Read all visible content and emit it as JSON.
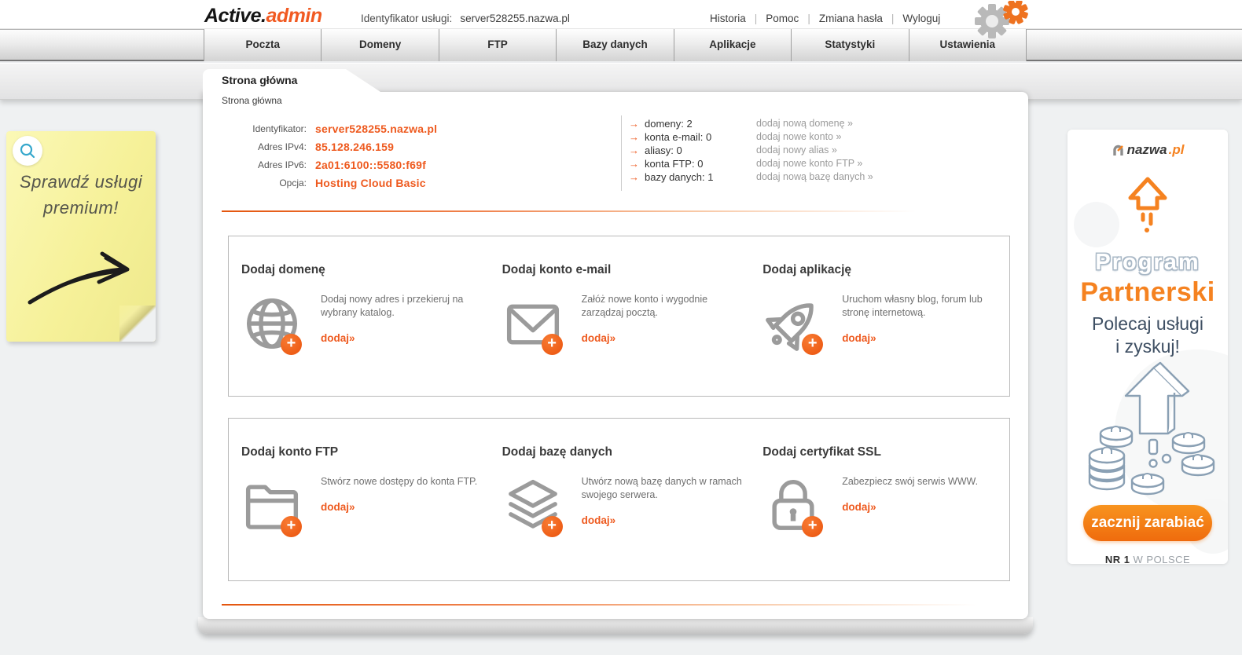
{
  "header": {
    "logo_part1": "Active.",
    "logo_part2": "admin",
    "service_label": "Identyfikator usługi:",
    "service_value": "server528255.nazwa.pl",
    "links": [
      "Historia",
      "Pomoc",
      "Zmiana hasła",
      "Wyloguj"
    ]
  },
  "nav": {
    "tabs": [
      "Poczta",
      "Domeny",
      "FTP",
      "Bazy danych",
      "Aplikacje",
      "Statystyki",
      "Ustawienia"
    ]
  },
  "page": {
    "tab_title": "Strona główna",
    "breadcrumb": "Strona główna"
  },
  "info": {
    "rows": [
      {
        "label": "Identyfikator:",
        "value": "server528255.nazwa.pl"
      },
      {
        "label": "Adres IPv4:",
        "value": "85.128.246.159"
      },
      {
        "label": "Adres IPv6:",
        "value": "2a01:6100::5580:f69f"
      },
      {
        "label": "Opcja:",
        "value": "Hosting Cloud Basic"
      }
    ],
    "stats": [
      {
        "label": "domeny: 2",
        "link": "dodaj nową domenę »"
      },
      {
        "label": "konta e-mail: 0",
        "link": "dodaj nowe konto »"
      },
      {
        "label": "aliasy: 0",
        "link": "dodaj nowy alias »"
      },
      {
        "label": "konta FTP: 0",
        "link": "dodaj nowe konto FTP »"
      },
      {
        "label": "bazy danych: 1",
        "link": "dodaj nową bazę danych »"
      }
    ]
  },
  "cards": {
    "row1": [
      {
        "title": "Dodaj domenę",
        "icon": "globe-icon",
        "description": "Dodaj nowy adres i przekieruj na wybrany katalog.",
        "link": "dodaj»"
      },
      {
        "title": "Dodaj konto e-mail",
        "icon": "envelope-icon",
        "description": "Załóż nowe konto i wygodnie zarządzaj pocztą.",
        "link": "dodaj»"
      },
      {
        "title": "Dodaj aplikację",
        "icon": "rocket-icon",
        "description": "Uruchom własny blog, forum lub stronę internetową.",
        "link": "dodaj»"
      }
    ],
    "row2": [
      {
        "title": "Dodaj konto FTP",
        "icon": "folder-icon",
        "description": "Stwórz nowe dostępy do konta FTP.",
        "link": "dodaj»"
      },
      {
        "title": "Dodaj bazę danych",
        "icon": "database-icon",
        "description": "Utwórz nową bazę danych w ramach swojego serwera.",
        "link": "dodaj»"
      },
      {
        "title": "Dodaj certyfikat SSL",
        "icon": "padlock-icon",
        "description": "Zabezpiecz swój serwis WWW.",
        "link": "dodaj»"
      }
    ]
  },
  "icons": {
    "arrow": "→",
    "plus": "+"
  },
  "promo_note": {
    "line1": "Sprawdź usługi",
    "line2": "premium!"
  },
  "ad": {
    "brand_name": "nazwa",
    "brand_tld": ".pl",
    "title1": "Program",
    "title2": "Partnerski",
    "subtitle1": "Polecaj usługi",
    "subtitle2": "i zyskuj!",
    "button": "zacznij zarabiać",
    "footnote_strong": "NR 1",
    "footnote_rest": " W POLSCE"
  },
  "colors": {
    "accent": "#ee5a1f",
    "ad_orange": "#f58220",
    "note_yellow": "#f6f199",
    "illustration_stroke": "#8aa0b4"
  }
}
